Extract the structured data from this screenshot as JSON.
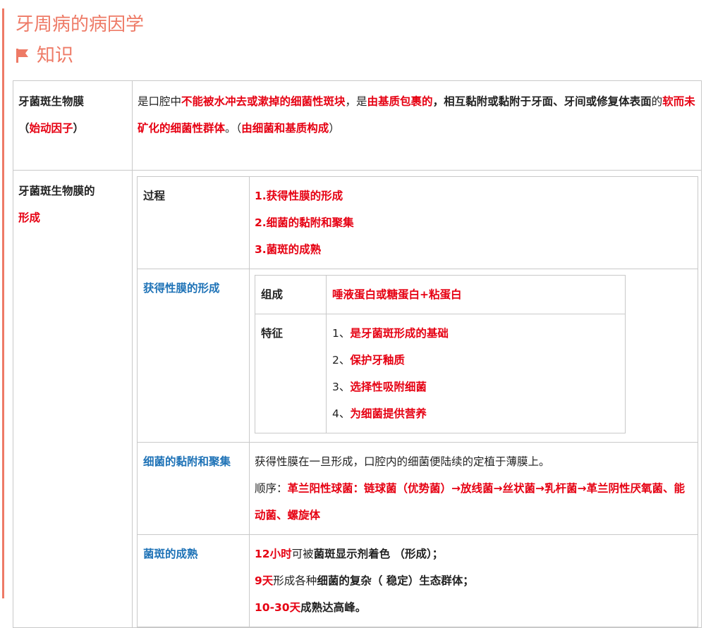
{
  "title": "牙周病的病因学",
  "subhead": {
    "label": "知识",
    "icon": "flag-icon",
    "color": "#ee7a66"
  },
  "colors": {
    "accent": "#ee7a66",
    "red": "#e60012",
    "blue": "#1f73b7"
  },
  "row1": {
    "label_line1": "牙菌斑生物膜",
    "label_paren_open": "（",
    "label_red": "始动因子",
    "label_paren_close": "）",
    "c_t1": "是口腔中",
    "c_r1": "不能被水冲去或漱掉的细菌性斑块",
    "c_t2": "，是",
    "c_r2": "由基质包裹的",
    "c_b1": "，相互黏附或黏附于牙面、牙间或修复体表面",
    "c_t3": "的",
    "c_r3": "软而未矿化的细菌性群体",
    "c_t4": "。（",
    "c_r4": "由细菌和基质构成",
    "c_t5": "）"
  },
  "row2": {
    "label_line1": "牙菌斑生物膜的",
    "label_red": "形成",
    "process": {
      "label": "过程",
      "steps": [
        "1.获得性膜的形成",
        "2.细菌的黏附和聚集",
        "3.菌斑的成熟"
      ]
    },
    "pellicle": {
      "label": "获得性膜的形成",
      "composition_label": "组成",
      "composition_value": "唾液蛋白或糖蛋白+粘蛋白",
      "feature_label": "特征",
      "features": [
        {
          "num": "1、",
          "text": "是牙菌斑形成的基础"
        },
        {
          "num": "2、",
          "text": "保护牙釉质"
        },
        {
          "num": "3、",
          "text": "选择性吸附细菌"
        },
        {
          "num": "4、",
          "text": "为细菌提供营养"
        }
      ]
    },
    "adhesion": {
      "label": "细菌的黏附和聚集",
      "line1": "获得性膜在一旦形成，口腔内的细菌便陆续的定植于薄膜上。",
      "order_label": "顺序：",
      "order_value": "革兰阳性球菌：链球菌（优势菌）→放线菌→丝状菌→乳杆菌→革兰阴性厌氧菌、能动菌、螺旋体"
    },
    "maturation": {
      "label": "菌斑的成熟",
      "l1_red": "12小时",
      "l1_t": "可被",
      "l1_b": "菌斑显示剂着色 （形成）；",
      "l2_red": "9天",
      "l2_t": "形成各种",
      "l2_b": "细菌的复杂（ 稳定）生态群体；",
      "l3_red": "10-30天",
      "l3_b": "成熟达高峰。"
    }
  }
}
